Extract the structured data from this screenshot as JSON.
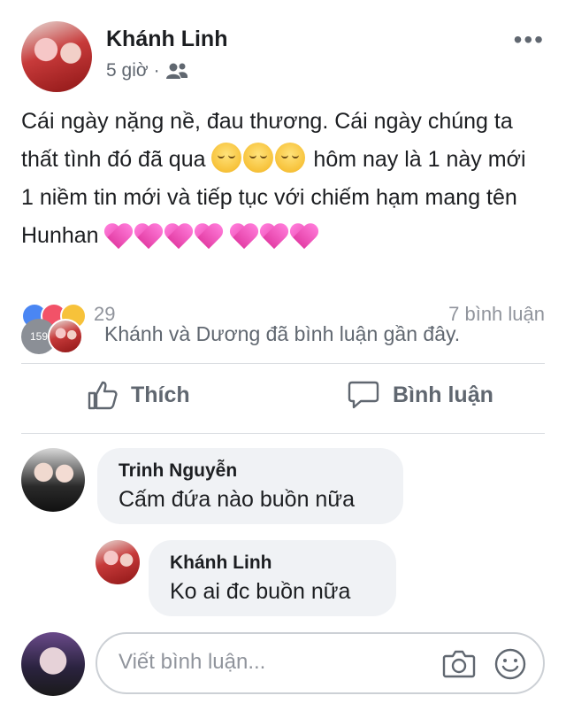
{
  "post": {
    "author": "Khánh Linh",
    "time": "5 giờ",
    "privacy_icon": "friends-icon",
    "text_part1": "Cái ngày nặng nề,  đau thương. Cái ngày chúng ta thất tình đó đã qua",
    "text_part2": " hôm nay là 1 này mới 1 niềm tin mới và tiếp tục với chiếm hạm mang tên Hunhan",
    "emoji_relieved": "relieved-face-emoji",
    "emoji_heart": "sparkling-heart-emoji"
  },
  "reactions": {
    "count": "29",
    "comment_count": "7 bình luận",
    "recent_badge": "159",
    "recent_text": "Khánh và Dương đã bình luận gần đây."
  },
  "actions": {
    "like_label": "Thích",
    "comment_label": "Bình luận"
  },
  "comments": [
    {
      "name": "Trinh Nguyễn",
      "text": "Cấm đứa nào buồn nữa"
    },
    {
      "name": "Khánh Linh",
      "text": "Ko ai đc buồn nữa"
    }
  ],
  "composer": {
    "placeholder": "Viết bình luận..."
  },
  "colors": {
    "text": "#1c1e21",
    "secondary": "#606770",
    "bubble": "#f0f2f5",
    "divider": "#dadde1"
  }
}
